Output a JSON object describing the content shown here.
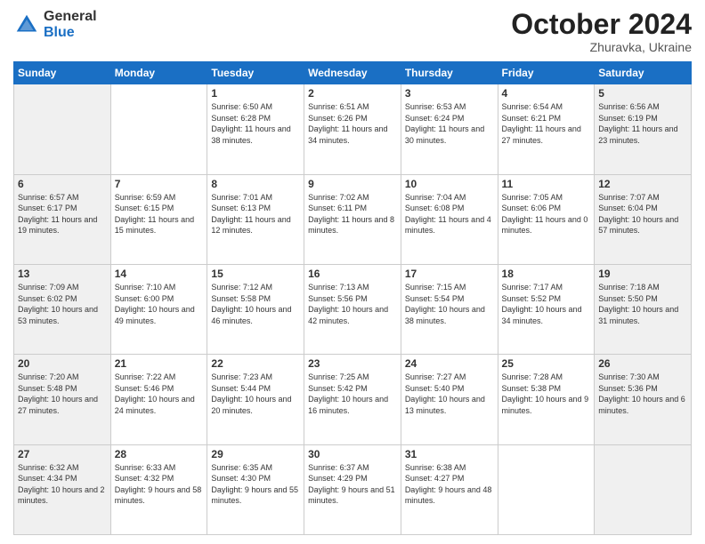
{
  "header": {
    "logo": {
      "general": "General",
      "blue": "Blue"
    },
    "title": "October 2024",
    "subtitle": "Zhuravka, Ukraine"
  },
  "days_of_week": [
    "Sunday",
    "Monday",
    "Tuesday",
    "Wednesday",
    "Thursday",
    "Friday",
    "Saturday"
  ],
  "weeks": [
    [
      {
        "day": "",
        "info": ""
      },
      {
        "day": "",
        "info": ""
      },
      {
        "day": "1",
        "info": "Sunrise: 6:50 AM\nSunset: 6:28 PM\nDaylight: 11 hours and 38 minutes."
      },
      {
        "day": "2",
        "info": "Sunrise: 6:51 AM\nSunset: 6:26 PM\nDaylight: 11 hours and 34 minutes."
      },
      {
        "day": "3",
        "info": "Sunrise: 6:53 AM\nSunset: 6:24 PM\nDaylight: 11 hours and 30 minutes."
      },
      {
        "day": "4",
        "info": "Sunrise: 6:54 AM\nSunset: 6:21 PM\nDaylight: 11 hours and 27 minutes."
      },
      {
        "day": "5",
        "info": "Sunrise: 6:56 AM\nSunset: 6:19 PM\nDaylight: 11 hours and 23 minutes."
      }
    ],
    [
      {
        "day": "6",
        "info": "Sunrise: 6:57 AM\nSunset: 6:17 PM\nDaylight: 11 hours and 19 minutes."
      },
      {
        "day": "7",
        "info": "Sunrise: 6:59 AM\nSunset: 6:15 PM\nDaylight: 11 hours and 15 minutes."
      },
      {
        "day": "8",
        "info": "Sunrise: 7:01 AM\nSunset: 6:13 PM\nDaylight: 11 hours and 12 minutes."
      },
      {
        "day": "9",
        "info": "Sunrise: 7:02 AM\nSunset: 6:11 PM\nDaylight: 11 hours and 8 minutes."
      },
      {
        "day": "10",
        "info": "Sunrise: 7:04 AM\nSunset: 6:08 PM\nDaylight: 11 hours and 4 minutes."
      },
      {
        "day": "11",
        "info": "Sunrise: 7:05 AM\nSunset: 6:06 PM\nDaylight: 11 hours and 0 minutes."
      },
      {
        "day": "12",
        "info": "Sunrise: 7:07 AM\nSunset: 6:04 PM\nDaylight: 10 hours and 57 minutes."
      }
    ],
    [
      {
        "day": "13",
        "info": "Sunrise: 7:09 AM\nSunset: 6:02 PM\nDaylight: 10 hours and 53 minutes."
      },
      {
        "day": "14",
        "info": "Sunrise: 7:10 AM\nSunset: 6:00 PM\nDaylight: 10 hours and 49 minutes."
      },
      {
        "day": "15",
        "info": "Sunrise: 7:12 AM\nSunset: 5:58 PM\nDaylight: 10 hours and 46 minutes."
      },
      {
        "day": "16",
        "info": "Sunrise: 7:13 AM\nSunset: 5:56 PM\nDaylight: 10 hours and 42 minutes."
      },
      {
        "day": "17",
        "info": "Sunrise: 7:15 AM\nSunset: 5:54 PM\nDaylight: 10 hours and 38 minutes."
      },
      {
        "day": "18",
        "info": "Sunrise: 7:17 AM\nSunset: 5:52 PM\nDaylight: 10 hours and 34 minutes."
      },
      {
        "day": "19",
        "info": "Sunrise: 7:18 AM\nSunset: 5:50 PM\nDaylight: 10 hours and 31 minutes."
      }
    ],
    [
      {
        "day": "20",
        "info": "Sunrise: 7:20 AM\nSunset: 5:48 PM\nDaylight: 10 hours and 27 minutes."
      },
      {
        "day": "21",
        "info": "Sunrise: 7:22 AM\nSunset: 5:46 PM\nDaylight: 10 hours and 24 minutes."
      },
      {
        "day": "22",
        "info": "Sunrise: 7:23 AM\nSunset: 5:44 PM\nDaylight: 10 hours and 20 minutes."
      },
      {
        "day": "23",
        "info": "Sunrise: 7:25 AM\nSunset: 5:42 PM\nDaylight: 10 hours and 16 minutes."
      },
      {
        "day": "24",
        "info": "Sunrise: 7:27 AM\nSunset: 5:40 PM\nDaylight: 10 hours and 13 minutes."
      },
      {
        "day": "25",
        "info": "Sunrise: 7:28 AM\nSunset: 5:38 PM\nDaylight: 10 hours and 9 minutes."
      },
      {
        "day": "26",
        "info": "Sunrise: 7:30 AM\nSunset: 5:36 PM\nDaylight: 10 hours and 6 minutes."
      }
    ],
    [
      {
        "day": "27",
        "info": "Sunrise: 6:32 AM\nSunset: 4:34 PM\nDaylight: 10 hours and 2 minutes."
      },
      {
        "day": "28",
        "info": "Sunrise: 6:33 AM\nSunset: 4:32 PM\nDaylight: 9 hours and 58 minutes."
      },
      {
        "day": "29",
        "info": "Sunrise: 6:35 AM\nSunset: 4:30 PM\nDaylight: 9 hours and 55 minutes."
      },
      {
        "day": "30",
        "info": "Sunrise: 6:37 AM\nSunset: 4:29 PM\nDaylight: 9 hours and 51 minutes."
      },
      {
        "day": "31",
        "info": "Sunrise: 6:38 AM\nSunset: 4:27 PM\nDaylight: 9 hours and 48 minutes."
      },
      {
        "day": "",
        "info": ""
      },
      {
        "day": "",
        "info": ""
      }
    ]
  ]
}
